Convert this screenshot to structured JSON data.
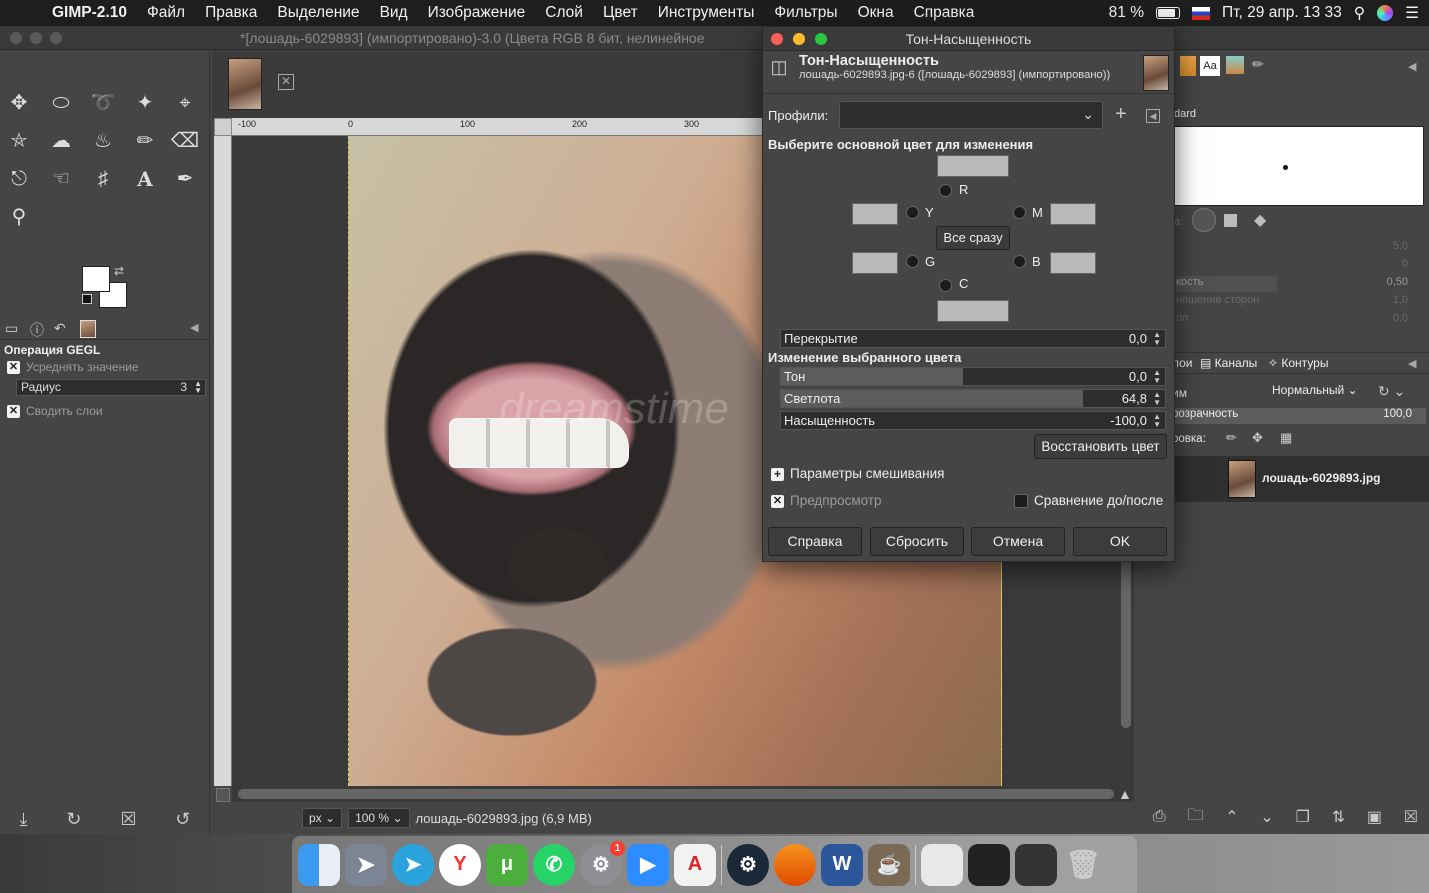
{
  "menubar": {
    "app": "GIMP-2.10",
    "items": [
      "Файл",
      "Правка",
      "Выделение",
      "Вид",
      "Изображение",
      "Слой",
      "Цвет",
      "Инструменты",
      "Фильтры",
      "Окна",
      "Справка"
    ],
    "battery": "81 %",
    "datetime": "Пт, 29 апр.  13 33"
  },
  "window": {
    "title": "*[лошадь-6029893] (импортировано)-3.0 (Цвета RGB 8 бит, нелинейное"
  },
  "toolbox": {
    "options_title": "Операция GEGL",
    "average_label": "Усреднять значение",
    "radius_label": "Радиус",
    "radius_value": "3",
    "merge_label": "Сводить слои"
  },
  "ruler": {
    "marks": [
      "-100",
      "0",
      "100",
      "200",
      "300"
    ]
  },
  "statusbar": {
    "unit": "px",
    "zoom": "100 %",
    "file": "лошадь-6029893.jpg (6,9 MB)"
  },
  "dialog": {
    "window_title": "Тон-Насыщенность",
    "header_title": "Тон-Насыщенность",
    "header_sub": "лошадь-6029893.jpg-6 ([лошадь-6029893] (импортировано))",
    "profiles_label": "Профили:",
    "select_label": "Выберите основной цвет для изменения",
    "colors": {
      "r": "R",
      "y": "Y",
      "m": "M",
      "g": "G",
      "b": "B",
      "c": "C"
    },
    "all_button": "Все сразу",
    "overlap_label": "Перекрытие",
    "overlap_value": "0,0",
    "adjust_label": "Изменение выбранного цвета",
    "hue_label": "Тон",
    "hue_value": "0,0",
    "light_label": "Светлота",
    "light_value": "64,8",
    "sat_label": "Насыщенность",
    "sat_value": "-100,0",
    "restore_button": "Восстановить цвет",
    "blend_label": "Параметры смешивания",
    "preview_label": "Предпросмотр",
    "compare_label": "Сравнение до/после",
    "help_button": "Справка",
    "reset_button": "Сбросить",
    "cancel_button": "Отмена",
    "ok_button": "OK"
  },
  "rightdock": {
    "brush_name": "dard",
    "shape_label": "а:",
    "row_labels": [
      "кость",
      "ношение сторон",
      "ол"
    ],
    "row_values": [
      "5,0",
      "0",
      "0,50",
      "1,0",
      "0,0"
    ],
    "tabs": [
      "лои",
      "Каналы",
      "Контуры"
    ],
    "mode_label": "им",
    "mode_value": "Нормальный",
    "opacity_label": "розрачность",
    "opacity_value": "100,0",
    "lock_label": "ровка:",
    "layer_name": "лошадь-6029893.jpg"
  },
  "watermark": "dreamstime",
  "dock": {
    "zoom_badge": "1",
    "word": "W",
    "acrobat": "A",
    "yandex": "Y"
  }
}
